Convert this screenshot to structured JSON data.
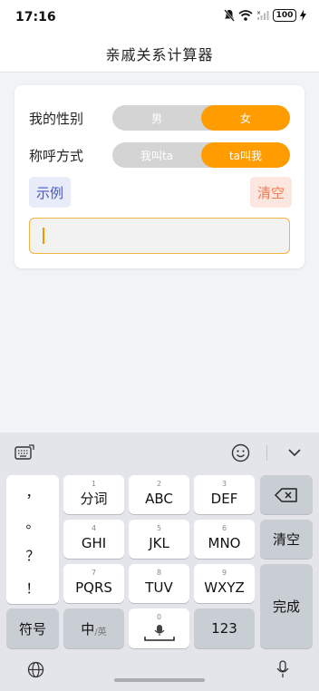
{
  "status": {
    "time": "17:16",
    "battery": "100"
  },
  "header": {
    "title": "亲戚关系计算器"
  },
  "form": {
    "gender_label": "我的性别",
    "gender_options": [
      "男",
      "女"
    ],
    "address_label": "称呼方式",
    "address_options": [
      "我叫ta",
      "ta叫我"
    ],
    "example_label": "示例",
    "clear_label": "清空",
    "input_value": ""
  },
  "keyboard": {
    "punctuation": [
      "，",
      "。",
      "？",
      "！"
    ],
    "keys_row1": [
      {
        "num": "1",
        "label": "分词"
      },
      {
        "num": "2",
        "label": "ABC"
      },
      {
        "num": "3",
        "label": "DEF"
      }
    ],
    "keys_row2": [
      {
        "num": "4",
        "label": "GHI"
      },
      {
        "num": "5",
        "label": "JKL"
      },
      {
        "num": "6",
        "label": "MNO"
      }
    ],
    "keys_row3": [
      {
        "num": "7",
        "label": "PQRS"
      },
      {
        "num": "8",
        "label": "TUV"
      },
      {
        "num": "9",
        "label": "WXYZ"
      }
    ],
    "clear_key": "清空",
    "enter_key": "完成",
    "symbol_key": "符号",
    "lang_key_main": "中",
    "lang_key_sub": "/英",
    "space_num": "0",
    "num_key": "123"
  },
  "colors": {
    "accent": "#ff9d00",
    "example_text": "#4657c6",
    "clear_text": "#ee7b52"
  },
  "icons": [
    "no-disturb-icon",
    "wifi-icon",
    "signal-icon",
    "battery-icon",
    "keyboard-settings-icon",
    "emoji-icon",
    "collapse-icon",
    "backspace-icon",
    "mic-icon",
    "globe-icon",
    "voice-input-icon"
  ]
}
